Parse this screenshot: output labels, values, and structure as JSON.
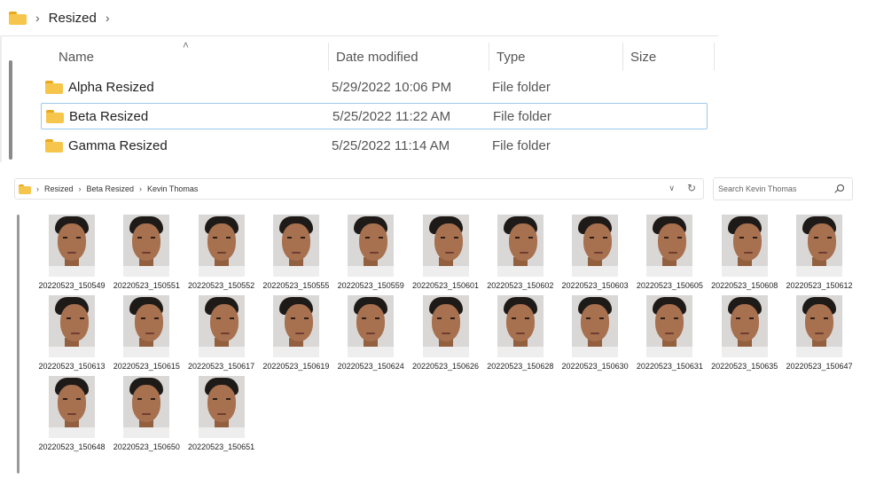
{
  "top_window": {
    "breadcrumb": {
      "icon": "folder-icon",
      "current": "Resized"
    },
    "columns": {
      "name": "Name",
      "date_modified": "Date modified",
      "type": "Type",
      "size": "Size"
    },
    "rows": [
      {
        "name": "Alpha Resized",
        "date": "5/29/2022 10:06 PM",
        "type": "File folder",
        "size": ""
      },
      {
        "name": "Beta Resized",
        "date": "5/25/2022 11:22 AM",
        "type": "File folder",
        "size": "",
        "selected": true
      },
      {
        "name": "Gamma Resized",
        "date": "5/25/2022 11:14 AM",
        "type": "File folder",
        "size": ""
      }
    ]
  },
  "bottom_window": {
    "address": {
      "parts": [
        "Resized",
        "Beta Resized",
        "Kevin Thomas"
      ]
    },
    "search": {
      "placeholder": "Search Kevin Thomas"
    },
    "files": [
      {
        "name": "20220523_150549",
        "view": "front"
      },
      {
        "name": "20220523_150551",
        "view": "front"
      },
      {
        "name": "20220523_150552",
        "view": "front"
      },
      {
        "name": "20220523_150555",
        "view": "front"
      },
      {
        "name": "20220523_150559",
        "view": "turned"
      },
      {
        "name": "20220523_150601",
        "view": "turned"
      },
      {
        "name": "20220523_150602",
        "view": "turned"
      },
      {
        "name": "20220523_150603",
        "view": "turned"
      },
      {
        "name": "20220523_150605",
        "view": "turned"
      },
      {
        "name": "20220523_150608",
        "view": "turned"
      },
      {
        "name": "20220523_150612",
        "view": "turned"
      },
      {
        "name": "20220523_150613",
        "view": "turned"
      },
      {
        "name": "20220523_150615",
        "view": "turned"
      },
      {
        "name": "20220523_150617",
        "view": "turned"
      },
      {
        "name": "20220523_150619",
        "view": "turned"
      },
      {
        "name": "20220523_150624",
        "view": "front"
      },
      {
        "name": "20220523_150626",
        "view": "front"
      },
      {
        "name": "20220523_150628",
        "view": "front"
      },
      {
        "name": "20220523_150630",
        "view": "front"
      },
      {
        "name": "20220523_150631",
        "view": "front"
      },
      {
        "name": "20220523_150635",
        "view": "front"
      },
      {
        "name": "20220523_150647",
        "view": "front"
      },
      {
        "name": "20220523_150648",
        "view": "front"
      },
      {
        "name": "20220523_150650",
        "view": "front"
      },
      {
        "name": "20220523_150651",
        "view": "front"
      }
    ]
  },
  "colors": {
    "folder": "#f6c64c",
    "folder_tab": "#e8a91f",
    "selection_border": "#9cc8ea"
  },
  "icons": [
    "folder-icon",
    "chevron-right-icon",
    "sort-up-icon",
    "chevron-down-icon",
    "refresh-icon",
    "search-icon"
  ]
}
